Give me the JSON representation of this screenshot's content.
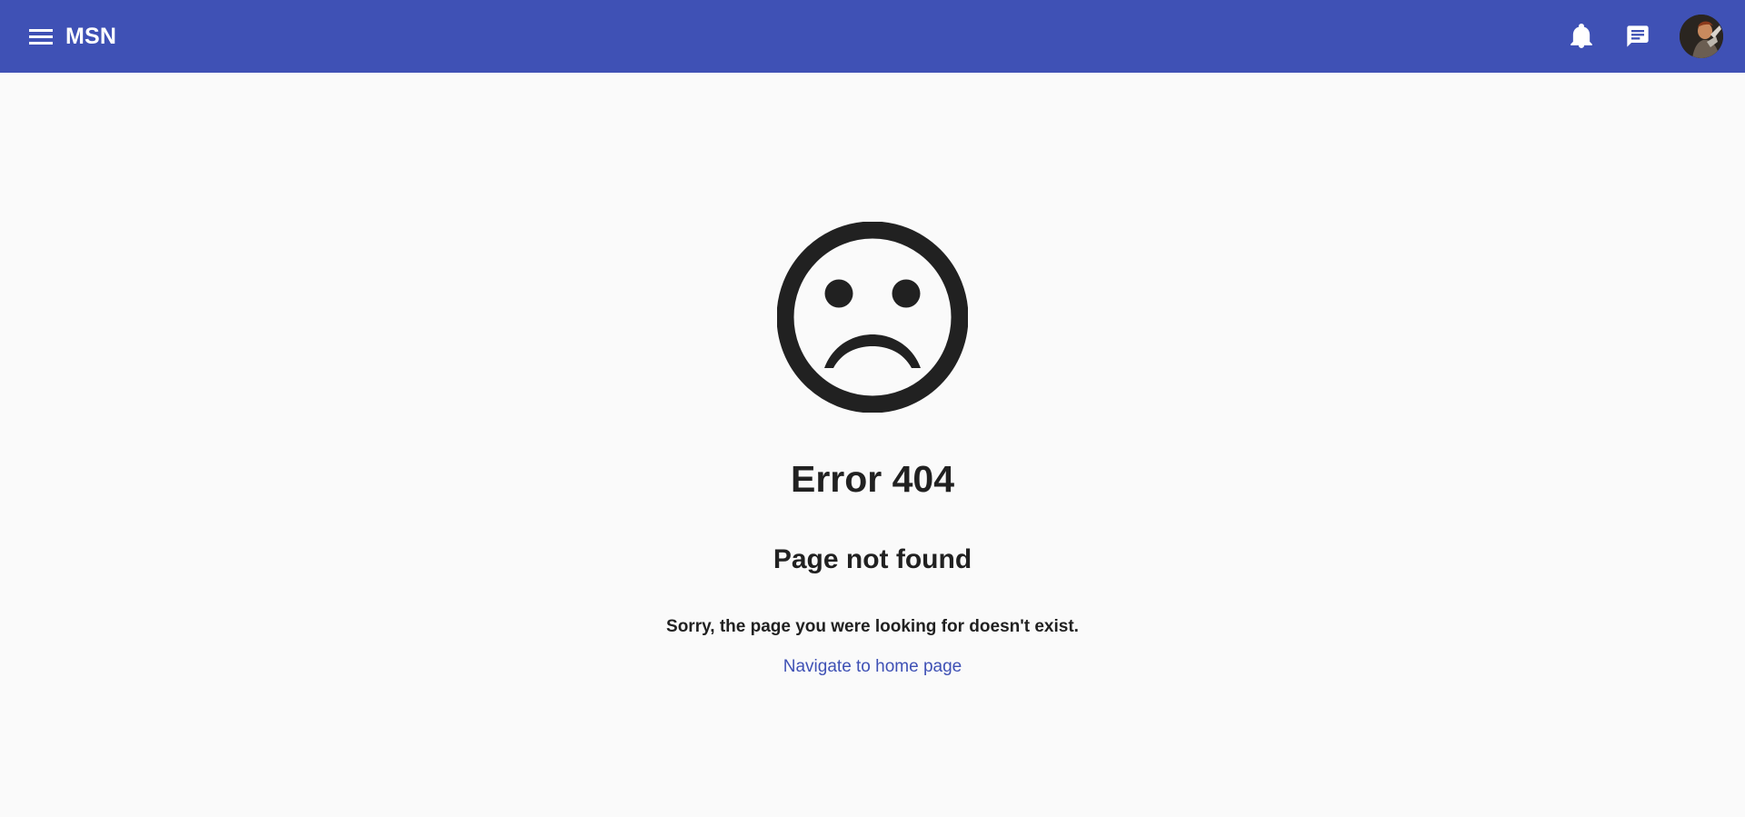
{
  "header": {
    "brand": "MSN",
    "icons": {
      "menu": "menu-icon",
      "notifications": "bell-icon",
      "messages": "chat-icon",
      "profile": "avatar"
    },
    "background_color": "#3f51b5"
  },
  "error": {
    "icon": "sad-face-icon",
    "title": "Error 404",
    "subtitle": "Page not found",
    "message": "Sorry, the page you were looking for doesn't exist.",
    "link_label": "Navigate to home page",
    "link_color": "#3f51b5"
  }
}
